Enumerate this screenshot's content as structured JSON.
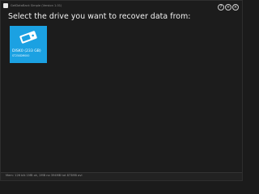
{
  "window": {
    "title": "GetDataBack Simple (Version 1.01)",
    "controls": [
      "?",
      "+",
      "×"
    ]
  },
  "main": {
    "heading": "Select the drive you want to recover data from:",
    "drives": [
      {
        "name": "DISK0 (233 GB)",
        "model": "ST250DM000",
        "icon": "hard-drive-icon",
        "color": "#1ba1e2"
      }
    ]
  },
  "status": {
    "text": "Mem: 126 blk 1MB ok, 2MB no 394MB tot 873MB avl"
  }
}
